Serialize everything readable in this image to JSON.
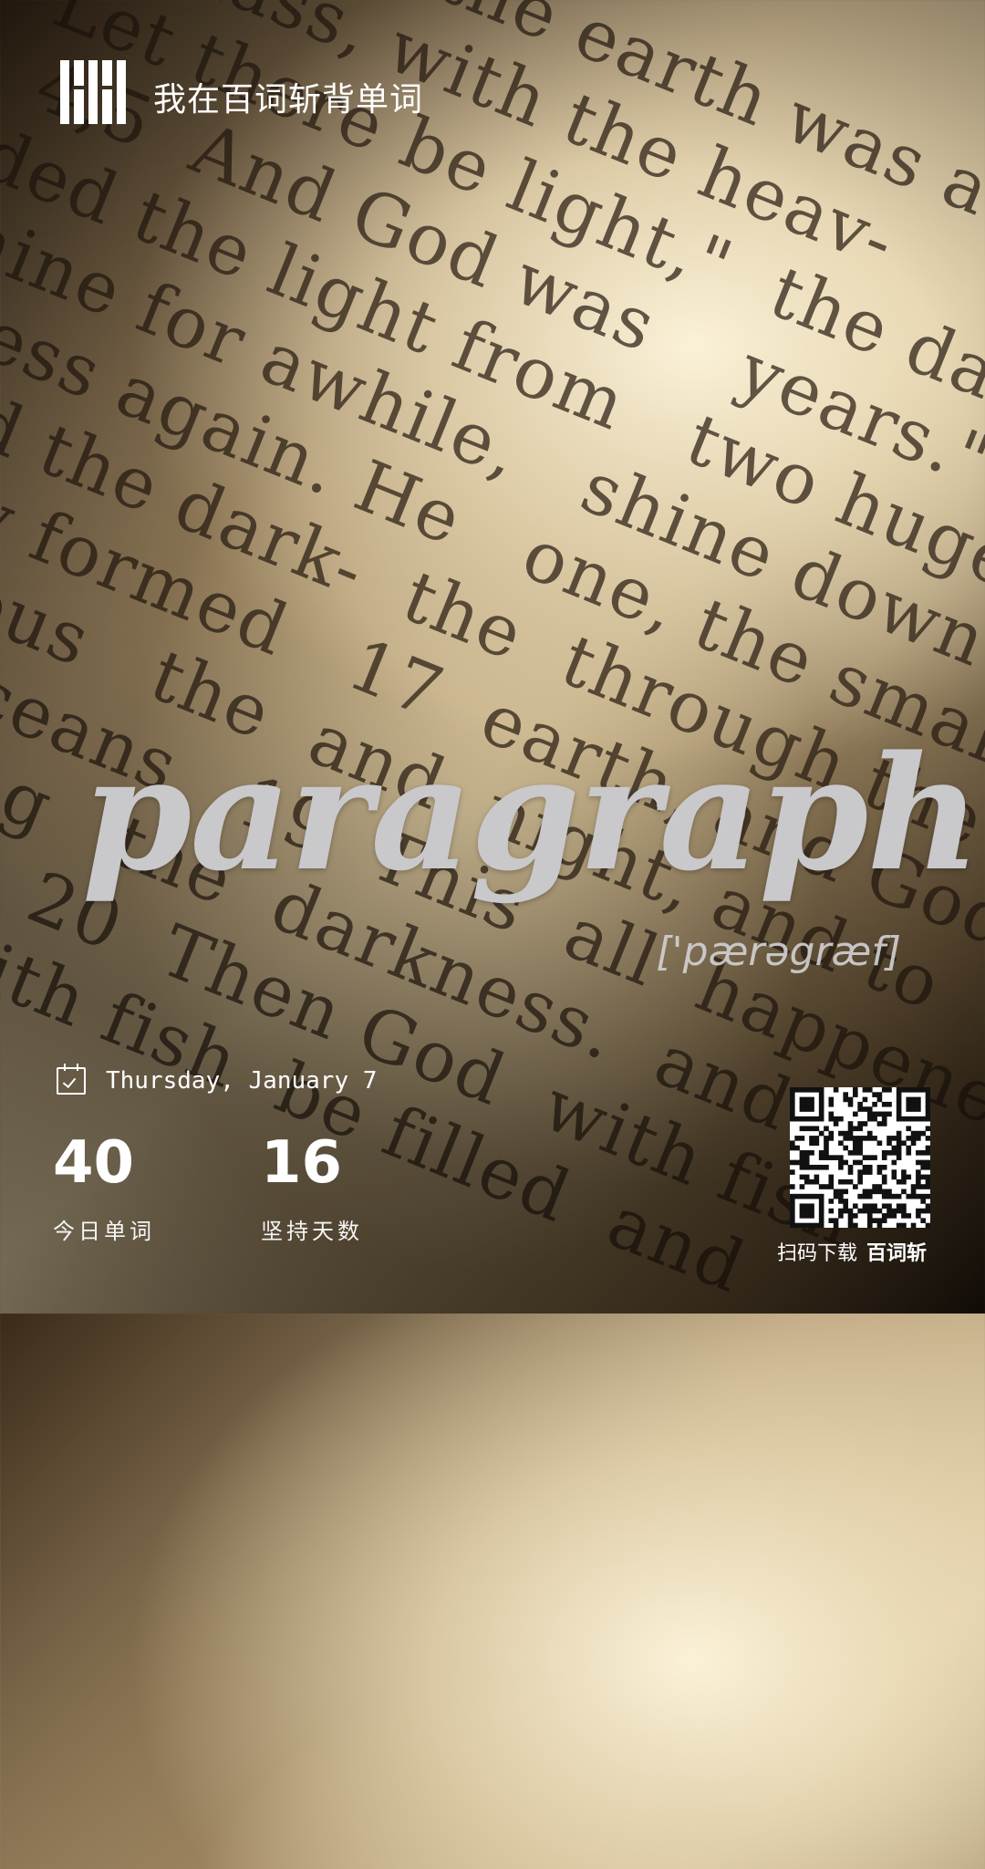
{
  "header": {
    "title": "我在百词斩背单词"
  },
  "card": {
    "word": "paragraph",
    "phonetic": "['pærəgræf]"
  },
  "footer": {
    "date": "Thursday, January 7",
    "stats": [
      {
        "value": "40",
        "label": "今日单词"
      },
      {
        "value": "16",
        "label": "坚持天数"
      }
    ],
    "qr_caption": "扫码下载",
    "qr_brand": "百词斩"
  },
  "icons": {
    "logo": "baicizhan-logo",
    "calendar": "calendar-check-icon",
    "qr": "qr-code"
  }
}
